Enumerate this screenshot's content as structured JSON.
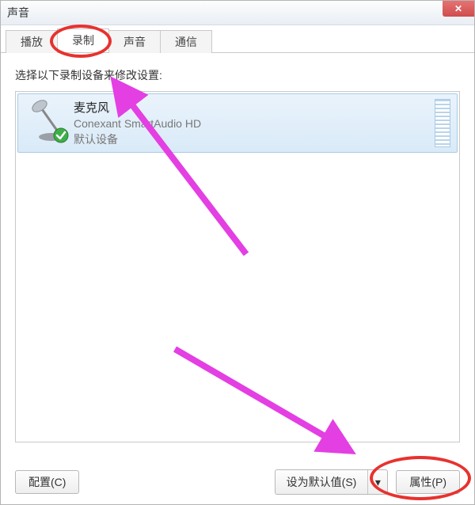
{
  "window": {
    "title": "声音"
  },
  "tabs": [
    {
      "label": "播放"
    },
    {
      "label": "录制"
    },
    {
      "label": "声音"
    },
    {
      "label": "通信"
    }
  ],
  "active_tab_index": 1,
  "instruction_text": "选择以下录制设备来修改设置:",
  "devices": [
    {
      "name": "麦克风",
      "driver": "Conexant SmartAudio HD",
      "status": "默认设备"
    }
  ],
  "buttons": {
    "configure": "配置(C)",
    "set_default": "设为默认值(S)",
    "properties": "属性(P)"
  }
}
